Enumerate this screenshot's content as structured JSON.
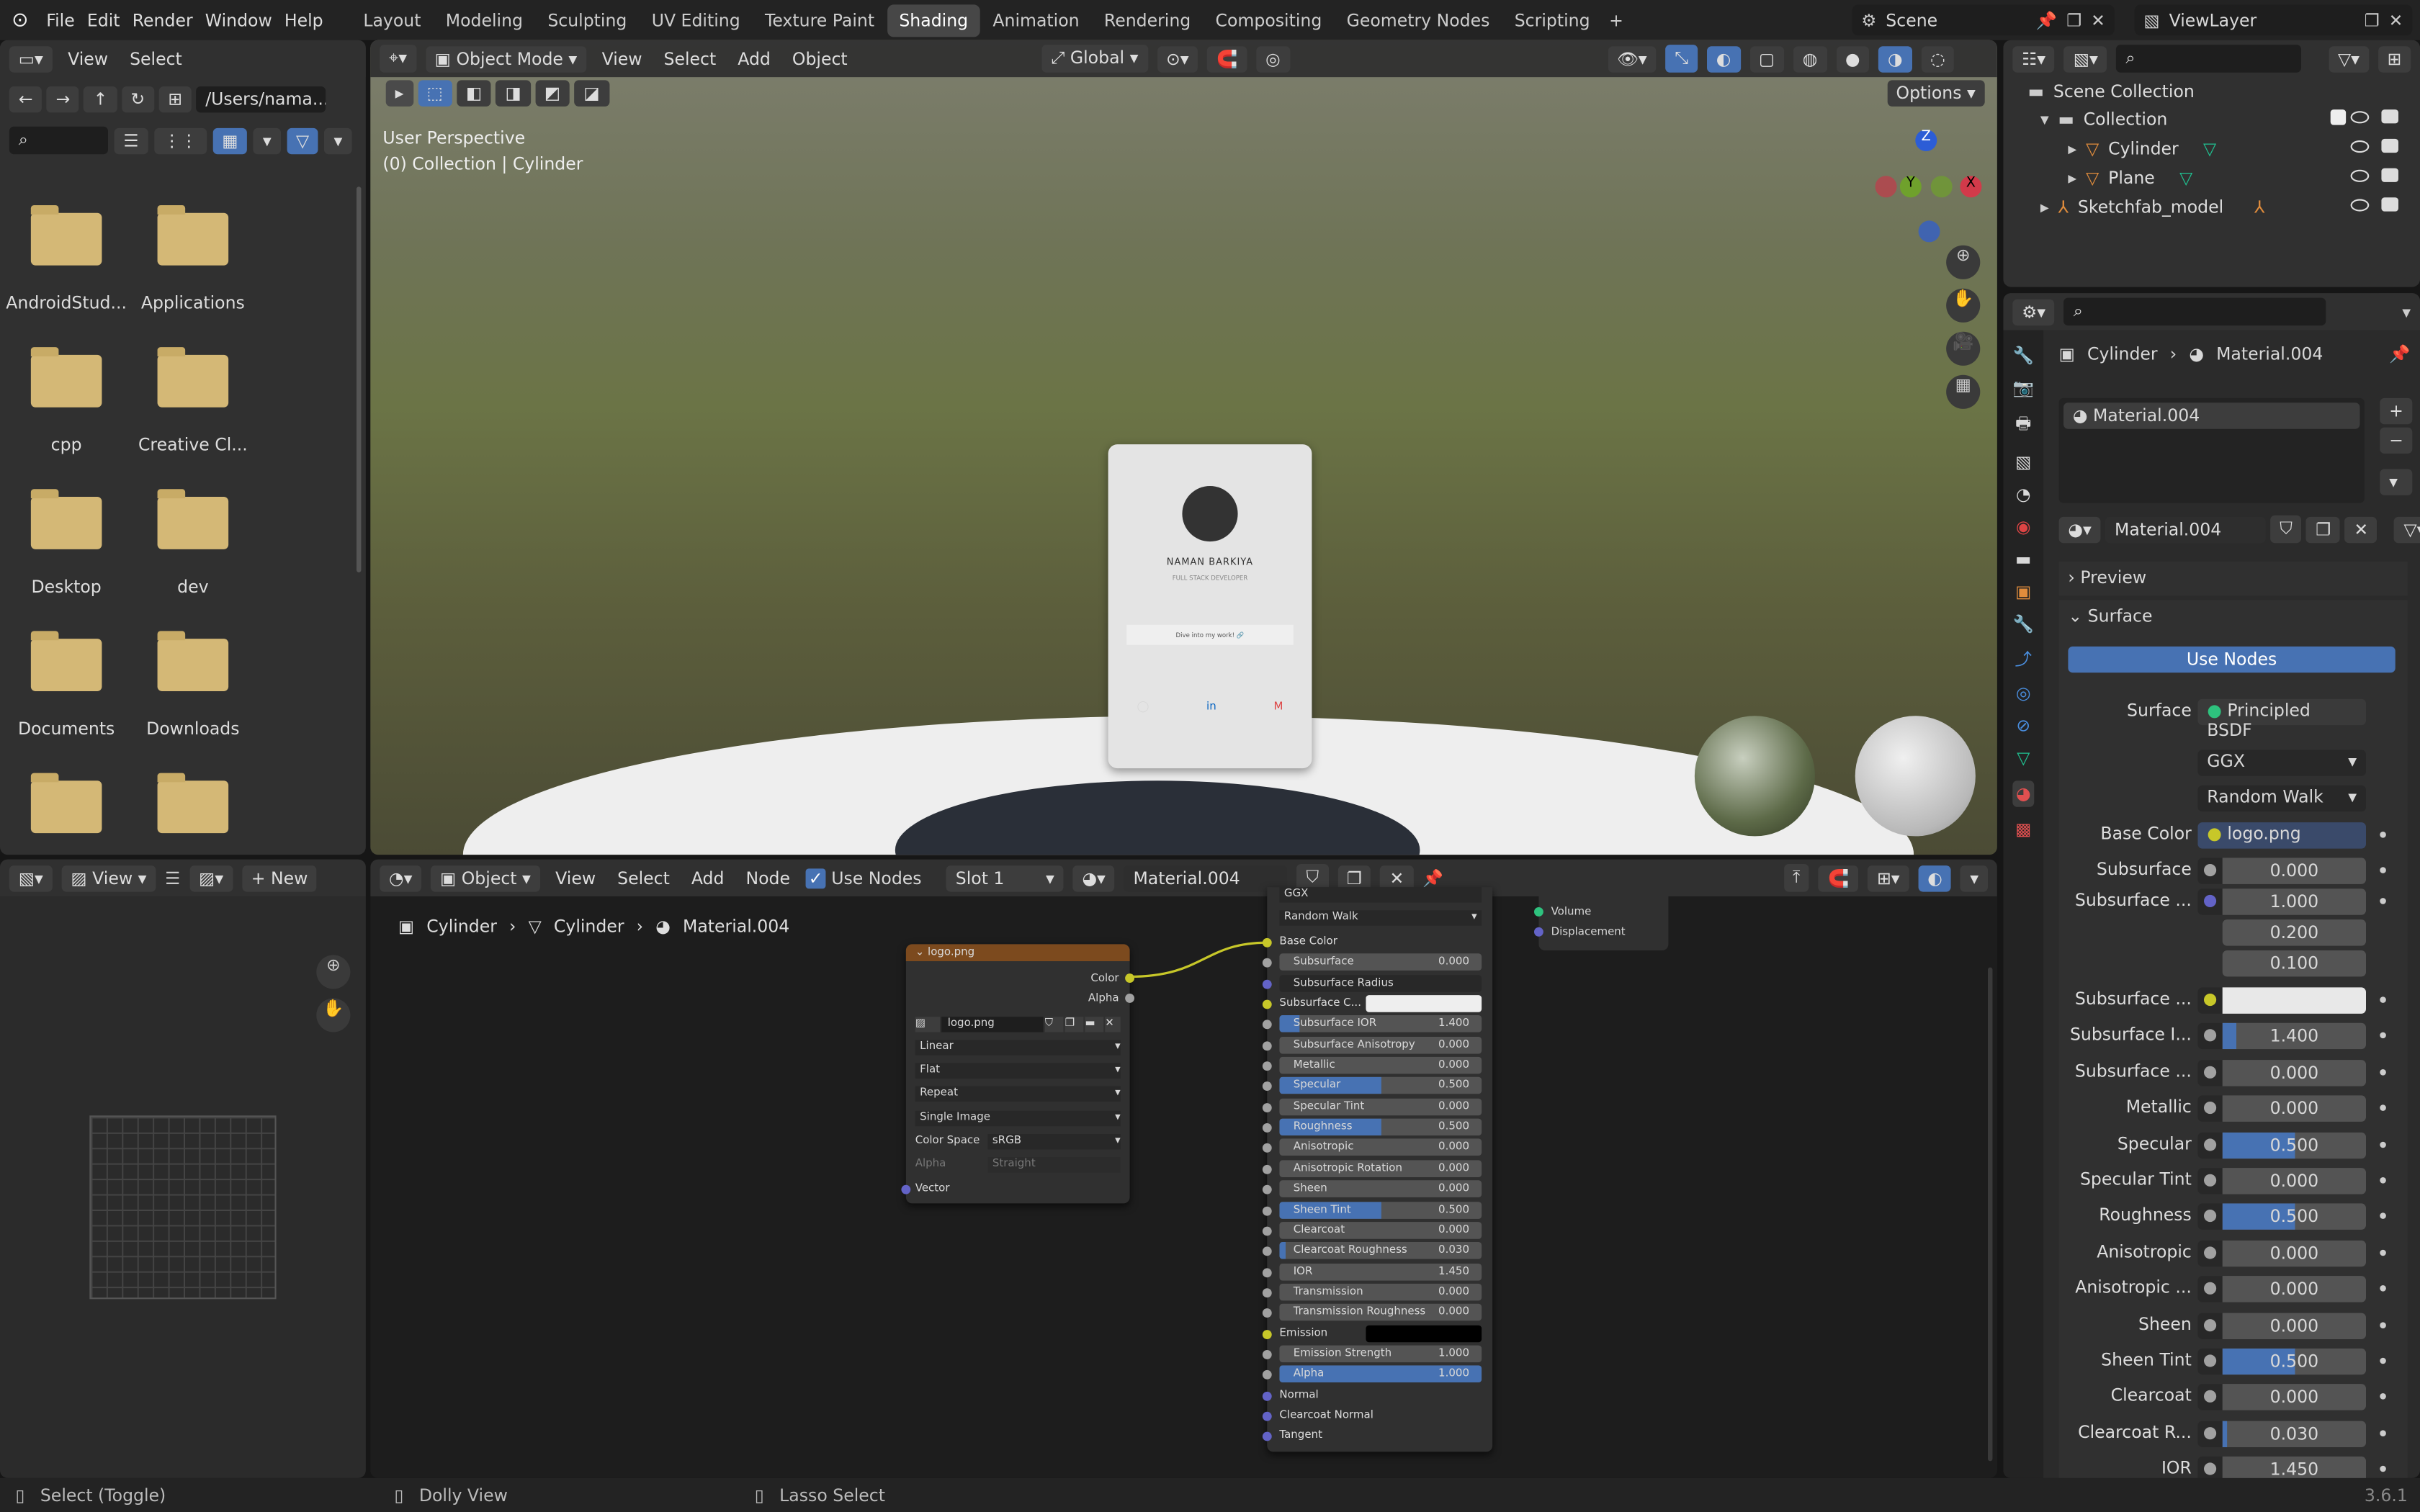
{
  "topbar": {
    "menus": [
      "File",
      "Edit",
      "Render",
      "Window",
      "Help"
    ],
    "workspaces": [
      "Layout",
      "Modeling",
      "Sculpting",
      "UV Editing",
      "Texture Paint",
      "Shading",
      "Animation",
      "Rendering",
      "Compositing",
      "Geometry Nodes",
      "Scripting"
    ],
    "active_workspace": "Shading",
    "scene": "Scene",
    "view_layer": "ViewLayer"
  },
  "file_browser": {
    "menus": [
      "View",
      "Select"
    ],
    "path": "/Users/nama...",
    "folders": [
      "AndroidStud...",
      "Applications",
      "cpp",
      "Creative Cl...",
      "Desktop",
      "dev",
      "Documents",
      "Downloads",
      "",
      ""
    ]
  },
  "viewport": {
    "mode": "Object Mode",
    "menus": [
      "View",
      "Select",
      "Add",
      "Object"
    ],
    "transform": "Global",
    "options": "Options",
    "info_line1": "User Perspective",
    "info_line2": "(0) Collection | Cylinder",
    "axes": {
      "x": "X",
      "y": "Y",
      "z": "Z"
    },
    "card": {
      "name": "NAMAN BARKIYA",
      "role": "FULL STACK DEVELOPER",
      "button": "Dive into my work! 🔗"
    }
  },
  "outliner": {
    "root": "Scene Collection",
    "items": [
      {
        "label": "Collection"
      },
      {
        "label": "Cylinder"
      },
      {
        "label": "Plane"
      },
      {
        "label": "Sketchfab_model"
      }
    ]
  },
  "properties": {
    "breadcrumb_object": "Cylinder",
    "breadcrumb_material": "Material.004",
    "slot": "Material.004",
    "material_name": "Material.004",
    "preview": "Preview",
    "surface_section": "Surface",
    "use_nodes": "Use Nodes",
    "surface_label": "Surface",
    "surface_shader": "Principled BSDF",
    "distribution": "GGX",
    "subsurface_method": "Random Walk",
    "base_color_label": "Base Color",
    "base_color_value": "logo.png",
    "rows": [
      {
        "label": "Subsurface",
        "value": "0.000",
        "fill": 0
      },
      {
        "label": "Subsurface ...",
        "value": "1.000",
        "fill": 0,
        "socket": "#6363c7"
      },
      {
        "label": "",
        "value": "0.200",
        "fill": 0,
        "sub": true
      },
      {
        "label": "",
        "value": "0.100",
        "fill": 0,
        "sub": true
      },
      {
        "label": "Subsurface ...",
        "value": "",
        "fill": 0,
        "socket": "#c7c729",
        "color": "#e8e8e8"
      },
      {
        "label": "Subsurface I...",
        "value": "1.400",
        "fill": 0.1
      },
      {
        "label": "Subsurface ...",
        "value": "0.000",
        "fill": 0
      },
      {
        "label": "Metallic",
        "value": "0.000",
        "fill": 0
      },
      {
        "label": "Specular",
        "value": "0.500",
        "fill": 0.5
      },
      {
        "label": "Specular Tint",
        "value": "0.000",
        "fill": 0
      },
      {
        "label": "Roughness",
        "value": "0.500",
        "fill": 0.5
      },
      {
        "label": "Anisotropic",
        "value": "0.000",
        "fill": 0
      },
      {
        "label": "Anisotropic ...",
        "value": "0.000",
        "fill": 0
      },
      {
        "label": "Sheen",
        "value": "0.000",
        "fill": 0
      },
      {
        "label": "Sheen Tint",
        "value": "0.500",
        "fill": 0.5
      },
      {
        "label": "Clearcoat",
        "value": "0.000",
        "fill": 0
      },
      {
        "label": "Clearcoat R...",
        "value": "0.030",
        "fill": 0.03
      },
      {
        "label": "IOR",
        "value": "1.450",
        "fill": 0
      }
    ]
  },
  "image_editor": {
    "view": "View",
    "new": "New"
  },
  "node_editor": {
    "type": "Object",
    "menus": [
      "View",
      "Select",
      "Add",
      "Node"
    ],
    "use_nodes": "Use Nodes",
    "slot": "Slot 1",
    "material": "Material.004",
    "breadcrumb": [
      "Cylinder",
      "Cylinder",
      "Material.004"
    ],
    "image_node": {
      "title": "logo.png",
      "out_color": "Color",
      "out_alpha": "Alpha",
      "image": "logo.png",
      "interpolation": "Linear",
      "projection": "Flat",
      "extension": "Repeat",
      "source": "Single Image",
      "color_space_label": "Color Space",
      "color_space": "sRGB",
      "alpha_label": "Alpha",
      "alpha_mode": "Straight",
      "in_vector": "Vector"
    },
    "bsdf": {
      "distribution": "GGX",
      "subsurface_method": "Random Walk",
      "base_color": "Base Color",
      "subsurface_radius": "Subsurface Radius",
      "subsurface_color": "Subsurface C...",
      "emission": "Emission",
      "normal": "Normal",
      "clearcoat_normal": "Clearcoat Normal",
      "tangent": "Tangent",
      "sliders": [
        {
          "label": "Subsurface",
          "value": "0.000",
          "fill": 0
        },
        {
          "label": "Subsurface IOR",
          "value": "1.400",
          "fill": 0.1
        },
        {
          "label": "Subsurface Anisotropy",
          "value": "0.000",
          "fill": 0
        },
        {
          "label": "Metallic",
          "value": "0.000",
          "fill": 0
        },
        {
          "label": "Specular",
          "value": "0.500",
          "fill": 0.5
        },
        {
          "label": "Specular Tint",
          "value": "0.000",
          "fill": 0
        },
        {
          "label": "Roughness",
          "value": "0.500",
          "fill": 0.5
        },
        {
          "label": "Anisotropic",
          "value": "0.000",
          "fill": 0
        },
        {
          "label": "Anisotropic Rotation",
          "value": "0.000",
          "fill": 0
        },
        {
          "label": "Sheen",
          "value": "0.000",
          "fill": 0
        },
        {
          "label": "Sheen Tint",
          "value": "0.500",
          "fill": 0.5
        },
        {
          "label": "Clearcoat",
          "value": "0.000",
          "fill": 0
        },
        {
          "label": "Clearcoat Roughness",
          "value": "0.030",
          "fill": 0.03
        },
        {
          "label": "IOR",
          "value": "1.450",
          "fill": 0
        },
        {
          "label": "Transmission",
          "value": "0.000",
          "fill": 0
        },
        {
          "label": "Transmission Roughness",
          "value": "0.000",
          "fill": 0
        },
        {
          "label": "Emission Strength",
          "value": "1.000",
          "fill": 0
        },
        {
          "label": "Alpha",
          "value": "1.000",
          "fill": 1
        }
      ]
    },
    "output_node": {
      "volume": "Volume",
      "displacement": "Displacement"
    }
  },
  "statusbar": {
    "left": "Select (Toggle)",
    "middle": "Dolly View",
    "right": "Lasso Select",
    "version": "3.6.1"
  },
  "colors": {
    "accent": "#4772b3",
    "folder": "#d4b876",
    "node_header_image": "#7c4a1e",
    "socket_yellow": "#c7c729",
    "socket_purple": "#6363c7",
    "socket_grey": "#a1a1a1"
  }
}
